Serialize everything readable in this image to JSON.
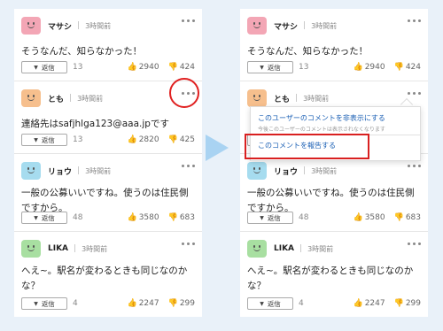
{
  "reply_label": "返信",
  "comments": [
    {
      "user": "マサシ",
      "time": "3時間前",
      "text": "そうなんだ、知らなかった！",
      "replies": "13",
      "up": "2940",
      "down": "424",
      "avatar": "avatar-pink"
    },
    {
      "user": "とも",
      "time": "3時間前",
      "text": "連絡先はsafjhlga123@aaa.jpです",
      "replies": "13",
      "up": "2820",
      "down": "425",
      "avatar": "avatar-orange"
    },
    {
      "user": "リョウ",
      "time": "3時間前",
      "text": "一般の公募いいですね。使うのは住民側ですから。",
      "replies": "48",
      "up": "3580",
      "down": "683",
      "avatar": "avatar-blue"
    },
    {
      "user": "LIKA",
      "time": "3時間前",
      "text": "へえ~。駅名が変わるときも同じなのかな？",
      "replies": "4",
      "up": "2247",
      "down": "299",
      "avatar": "avatar-green"
    }
  ],
  "menu": {
    "hide_user": "このユーザーのコメントを非表示にする",
    "hide_note": "今後このユーザーのコメントは表示されなくなります",
    "report": "このコメントを報告する"
  },
  "colors": {
    "highlight": "#e02020",
    "link": "#1a5fb4",
    "arrow": "#a9d3f2",
    "background": "#e9f1f9"
  }
}
